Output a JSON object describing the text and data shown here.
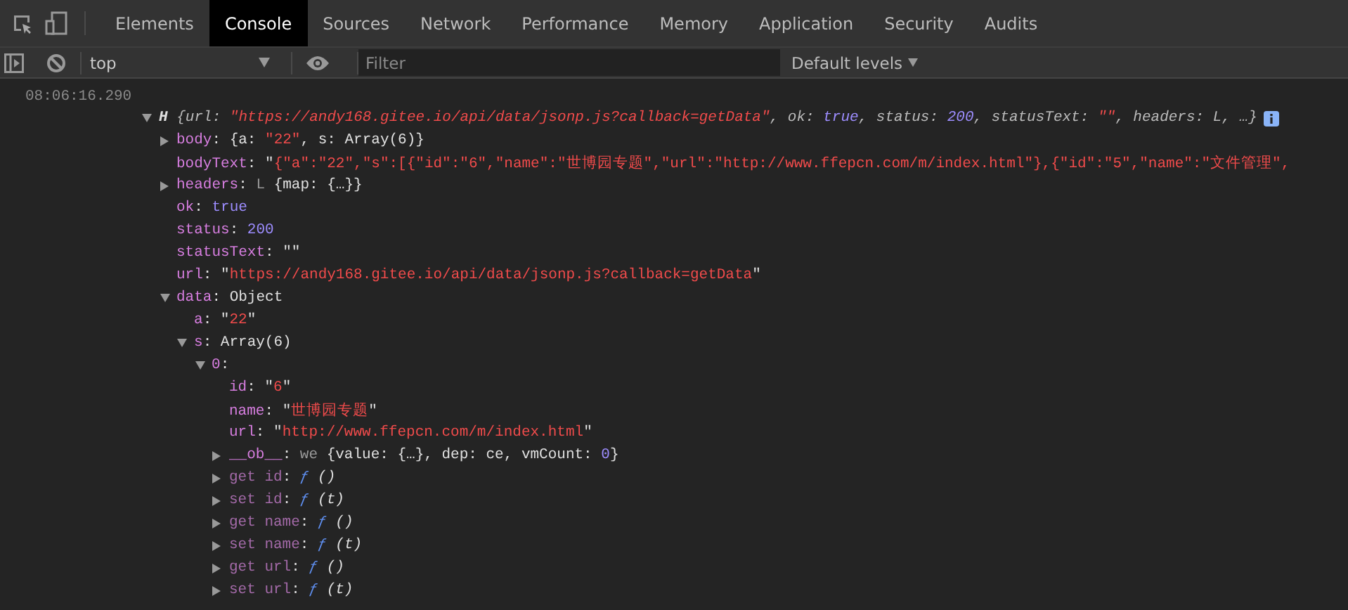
{
  "tabs": [
    {
      "label": "Elements",
      "selected": false
    },
    {
      "label": "Console",
      "selected": true
    },
    {
      "label": "Sources",
      "selected": false
    },
    {
      "label": "Network",
      "selected": false
    },
    {
      "label": "Performance",
      "selected": false
    },
    {
      "label": "Memory",
      "selected": false
    },
    {
      "label": "Application",
      "selected": false
    },
    {
      "label": "Security",
      "selected": false
    },
    {
      "label": "Audits",
      "selected": false
    }
  ],
  "toolbar": {
    "context": "top",
    "filter_placeholder": "Filter",
    "levels": "Default levels"
  },
  "log": {
    "timestamp": "08:06:16.290",
    "root": {
      "expanded": true,
      "parts": [
        {
          "kind": "preview_class",
          "text": "H "
        },
        {
          "kind": "preview",
          "text": "{url: "
        },
        {
          "kind": "preview_string",
          "text": "\"https://andy168.gitee.io/api/data/jsonp.js?callback=getData\""
        },
        {
          "kind": "preview",
          "text": ", ok: "
        },
        {
          "kind": "preview_number",
          "text": "true"
        },
        {
          "kind": "preview",
          "text": ", status: "
        },
        {
          "kind": "preview_number",
          "text": "200"
        },
        {
          "kind": "preview",
          "text": ", statusText: "
        },
        {
          "kind": "preview_string",
          "text": "\"\""
        },
        {
          "kind": "preview",
          "text": ", headers: L, …}"
        }
      ],
      "children": [
        {
          "expanded": false,
          "parts": [
            {
              "kind": "key",
              "text": "body"
            },
            {
              "kind": "punct",
              "text": ": {a: "
            },
            {
              "kind": "string",
              "text": "\"22\""
            },
            {
              "kind": "punct",
              "text": ", s: Array(6)}"
            }
          ]
        },
        {
          "parts": [
            {
              "kind": "key",
              "text": "bodyText"
            },
            {
              "kind": "punct",
              "text": ": \""
            },
            {
              "kind": "string",
              "text": "{\"a\":\"22\",\"s\":[{\"id\":\"6\",\"name\":\"世博园专题\",\"url\":\"http://www.ffepcn.com/m/index.html\"},{\"id\":\"5\",\"name\":\"文件管理\","
            }
          ]
        },
        {
          "expanded": false,
          "parts": [
            {
              "kind": "key",
              "text": "headers"
            },
            {
              "kind": "punct",
              "text": ": "
            },
            {
              "kind": "class",
              "text": "L "
            },
            {
              "kind": "punct",
              "text": "{map: {…}}"
            }
          ]
        },
        {
          "parts": [
            {
              "kind": "key",
              "text": "ok"
            },
            {
              "kind": "punct",
              "text": ": "
            },
            {
              "kind": "number",
              "text": "true"
            }
          ]
        },
        {
          "parts": [
            {
              "kind": "key",
              "text": "status"
            },
            {
              "kind": "punct",
              "text": ": "
            },
            {
              "kind": "number",
              "text": "200"
            }
          ]
        },
        {
          "parts": [
            {
              "kind": "key",
              "text": "statusText"
            },
            {
              "kind": "punct",
              "text": ": \"\""
            }
          ]
        },
        {
          "parts": [
            {
              "kind": "key",
              "text": "url"
            },
            {
              "kind": "punct",
              "text": ": \""
            },
            {
              "kind": "string",
              "text": "https://andy168.gitee.io/api/data/jsonp.js?callback=getData"
            },
            {
              "kind": "punct",
              "text": "\""
            }
          ]
        },
        {
          "expanded": true,
          "parts": [
            {
              "kind": "key",
              "text": "data"
            },
            {
              "kind": "punct",
              "text": ": Object"
            }
          ],
          "children": [
            {
              "parts": [
                {
                  "kind": "key",
                  "text": "a"
                },
                {
                  "kind": "punct",
                  "text": ": \""
                },
                {
                  "kind": "string",
                  "text": "22"
                },
                {
                  "kind": "punct",
                  "text": "\""
                }
              ]
            },
            {
              "expanded": true,
              "parts": [
                {
                  "kind": "key",
                  "text": "s"
                },
                {
                  "kind": "punct",
                  "text": ": Array(6)"
                }
              ],
              "children": [
                {
                  "expanded": true,
                  "parts": [
                    {
                      "kind": "key",
                      "text": "0"
                    },
                    {
                      "kind": "punct",
                      "text": ":"
                    }
                  ],
                  "children": [
                    {
                      "parts": [
                        {
                          "kind": "key",
                          "text": "id"
                        },
                        {
                          "kind": "punct",
                          "text": ": \""
                        },
                        {
                          "kind": "string",
                          "text": "6"
                        },
                        {
                          "kind": "punct",
                          "text": "\""
                        }
                      ]
                    },
                    {
                      "parts": [
                        {
                          "kind": "key",
                          "text": "name"
                        },
                        {
                          "kind": "punct",
                          "text": ": \""
                        },
                        {
                          "kind": "string",
                          "text": "世博园专题"
                        },
                        {
                          "kind": "punct",
                          "text": "\""
                        }
                      ]
                    },
                    {
                      "parts": [
                        {
                          "kind": "key",
                          "text": "url"
                        },
                        {
                          "kind": "punct",
                          "text": ": \""
                        },
                        {
                          "kind": "string",
                          "text": "http://www.ffepcn.com/m/index.html"
                        },
                        {
                          "kind": "punct",
                          "text": "\""
                        }
                      ]
                    },
                    {
                      "expanded": false,
                      "parts": [
                        {
                          "kind": "key",
                          "text": "__ob__"
                        },
                        {
                          "kind": "punct",
                          "text": ": "
                        },
                        {
                          "kind": "class",
                          "text": "we "
                        },
                        {
                          "kind": "punct",
                          "text": "{value: {…}, dep: ce, vmCount: "
                        },
                        {
                          "kind": "number",
                          "text": "0"
                        },
                        {
                          "kind": "punct",
                          "text": "}"
                        }
                      ]
                    },
                    {
                      "expanded": false,
                      "parts": [
                        {
                          "kind": "key_dim",
                          "text": "get id"
                        },
                        {
                          "kind": "punct",
                          "text": ": "
                        },
                        {
                          "kind": "func",
                          "text": "ƒ"
                        },
                        {
                          "kind": "sig",
                          "text": " ()"
                        }
                      ]
                    },
                    {
                      "expanded": false,
                      "parts": [
                        {
                          "kind": "key_dim",
                          "text": "set id"
                        },
                        {
                          "kind": "punct",
                          "text": ": "
                        },
                        {
                          "kind": "func",
                          "text": "ƒ"
                        },
                        {
                          "kind": "sig",
                          "text": " (t)"
                        }
                      ]
                    },
                    {
                      "expanded": false,
                      "parts": [
                        {
                          "kind": "key_dim",
                          "text": "get name"
                        },
                        {
                          "kind": "punct",
                          "text": ": "
                        },
                        {
                          "kind": "func",
                          "text": "ƒ"
                        },
                        {
                          "kind": "sig",
                          "text": " ()"
                        }
                      ]
                    },
                    {
                      "expanded": false,
                      "parts": [
                        {
                          "kind": "key_dim",
                          "text": "set name"
                        },
                        {
                          "kind": "punct",
                          "text": ": "
                        },
                        {
                          "kind": "func",
                          "text": "ƒ"
                        },
                        {
                          "kind": "sig",
                          "text": " (t)"
                        }
                      ]
                    },
                    {
                      "expanded": false,
                      "parts": [
                        {
                          "kind": "key_dim",
                          "text": "get url"
                        },
                        {
                          "kind": "punct",
                          "text": ": "
                        },
                        {
                          "kind": "func",
                          "text": "ƒ"
                        },
                        {
                          "kind": "sig",
                          "text": " ()"
                        }
                      ]
                    },
                    {
                      "expanded": false,
                      "parts": [
                        {
                          "kind": "key_dim",
                          "text": "set url"
                        },
                        {
                          "kind": "punct",
                          "text": ": "
                        },
                        {
                          "kind": "func",
                          "text": "ƒ"
                        },
                        {
                          "kind": "sig",
                          "text": " (t)"
                        }
                      ]
                    }
                  ]
                }
              ]
            }
          ]
        }
      ]
    }
  }
}
